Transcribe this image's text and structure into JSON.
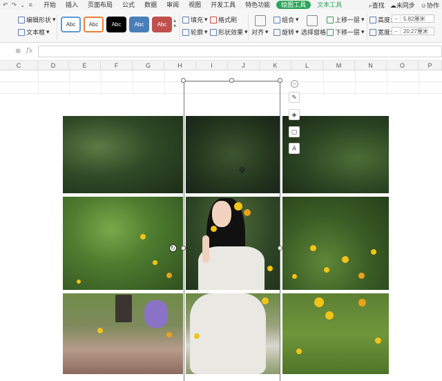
{
  "quick_access": [
    "↶",
    "↷",
    "⌄",
    "≡"
  ],
  "menu": {
    "tabs": [
      {
        "label": "开始",
        "state": "normal"
      },
      {
        "label": "插入",
        "state": "normal"
      },
      {
        "label": "页面布局",
        "state": "normal"
      },
      {
        "label": "公式",
        "state": "normal"
      },
      {
        "label": "数据",
        "state": "normal"
      },
      {
        "label": "审阅",
        "state": "normal"
      },
      {
        "label": "视图",
        "state": "normal"
      },
      {
        "label": "开发工具",
        "state": "normal"
      },
      {
        "label": "特色功能",
        "state": "normal"
      },
      {
        "label": "绘图工具",
        "state": "active"
      },
      {
        "label": "文本工具",
        "state": "text"
      }
    ],
    "search_label": "查找",
    "sync_label": "未同步",
    "collab_label": "协作"
  },
  "ribbon": {
    "edit_shape": "编辑形状",
    "text_box": "文本框",
    "shape_styles": [
      {
        "label": "Abc",
        "fill": "#ffffff",
        "border": "#5b9bd5",
        "text": "#333333"
      },
      {
        "label": "Abc",
        "fill": "#ffffff",
        "border": "#ed7d31",
        "text": "#333333"
      },
      {
        "label": "Abc",
        "fill": "#000000",
        "border": "#000000",
        "text": "#ffffff"
      },
      {
        "label": "Abc",
        "fill": "#4a7ebb",
        "border": "#4a7ebb",
        "text": "#ffffff"
      },
      {
        "label": "Abc",
        "fill": "#c0504d",
        "border": "#c0504d",
        "text": "#ffffff"
      }
    ],
    "fill": "填充",
    "outline": "轮廓",
    "format_brush": "格式刷",
    "shape_effects": "形状效果",
    "align": "对齐",
    "group": "组合",
    "rotate": "旋转",
    "selection_pane": "选择窗格",
    "bring_forward": "上移一层",
    "send_backward": "下移一层",
    "height_label": "高度:",
    "height_value": "5.82厘米",
    "width_label": "宽度:",
    "width_value": "20.27厘米"
  },
  "formula_bar": {
    "zoom_icon": "⊕",
    "fx": "fx",
    "value": ""
  },
  "columns": [
    "C",
    "D",
    "E",
    "F",
    "G",
    "H",
    "I",
    "J",
    "K",
    "L",
    "M",
    "N",
    "O",
    "P"
  ],
  "side_tools": {
    "collapse": "−",
    "pen": "✎",
    "fill": "◈",
    "frame": "▢",
    "text": "A"
  },
  "colors": {
    "accent_green": "#2fa55b",
    "ribbon_bg": "#f7f7f7"
  }
}
